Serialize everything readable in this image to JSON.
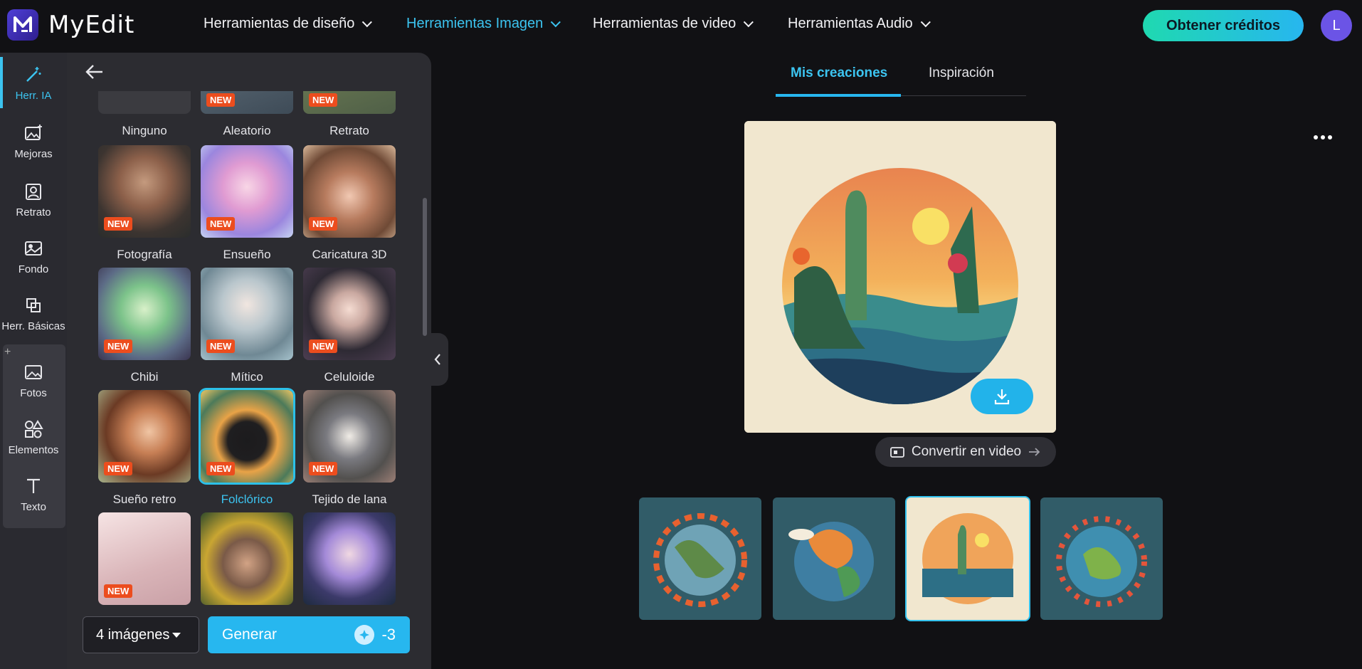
{
  "app": {
    "name": "MyEdit"
  },
  "nav": [
    {
      "label": "Herramientas de diseño",
      "active": false
    },
    {
      "label": "Herramientas Imagen",
      "active": true
    },
    {
      "label": "Herramientas de video",
      "active": false
    },
    {
      "label": "Herramientas Audio",
      "active": false
    }
  ],
  "header": {
    "credits_label": "Obtener créditos",
    "avatar_initial": "L"
  },
  "rail": [
    {
      "label": "Herr. IA",
      "icon": "magic-wand-icon"
    },
    {
      "label": "Mejoras",
      "icon": "image-enhance-icon"
    },
    {
      "label": "Retrato",
      "icon": "portrait-icon"
    },
    {
      "label": "Fondo",
      "icon": "background-icon"
    },
    {
      "label": "Herr. Básicas",
      "icon": "crop-icon"
    },
    {
      "label": "Fotos",
      "icon": "photo-icon"
    },
    {
      "label": "Elementos",
      "icon": "shapes-icon"
    },
    {
      "label": "Texto",
      "icon": "text-icon"
    }
  ],
  "rail_plus": "+",
  "styles": [
    {
      "label": "Ninguno",
      "badge": ""
    },
    {
      "label": "Aleatorio",
      "badge": "NEW"
    },
    {
      "label": "Retrato",
      "badge": "NEW"
    },
    {
      "label": "Fotografía",
      "badge": "NEW"
    },
    {
      "label": "Ensueño",
      "badge": "NEW"
    },
    {
      "label": "Caricatura 3D",
      "badge": "NEW"
    },
    {
      "label": "Chibi",
      "badge": "NEW"
    },
    {
      "label": "Mítico",
      "badge": "NEW"
    },
    {
      "label": "Celuloide",
      "badge": "NEW"
    },
    {
      "label": "Sueño retro",
      "badge": "NEW"
    },
    {
      "label": "Folclórico",
      "badge": "NEW"
    },
    {
      "label": "Tejido de lana",
      "badge": "NEW"
    },
    {
      "label": "",
      "badge": "NEW"
    },
    {
      "label": "",
      "badge": ""
    },
    {
      "label": "",
      "badge": ""
    }
  ],
  "generate": {
    "count_label": "4 imágenes",
    "button_label": "Generar",
    "cost": "-3"
  },
  "tabs": [
    {
      "label": "Mis creaciones"
    },
    {
      "label": "Inspiración"
    }
  ],
  "main": {
    "convert_label": "Convertir en video"
  },
  "colors": {
    "accent": "#27b7ef",
    "badge": "#ec4d1e",
    "panel": "#2c2c31"
  }
}
